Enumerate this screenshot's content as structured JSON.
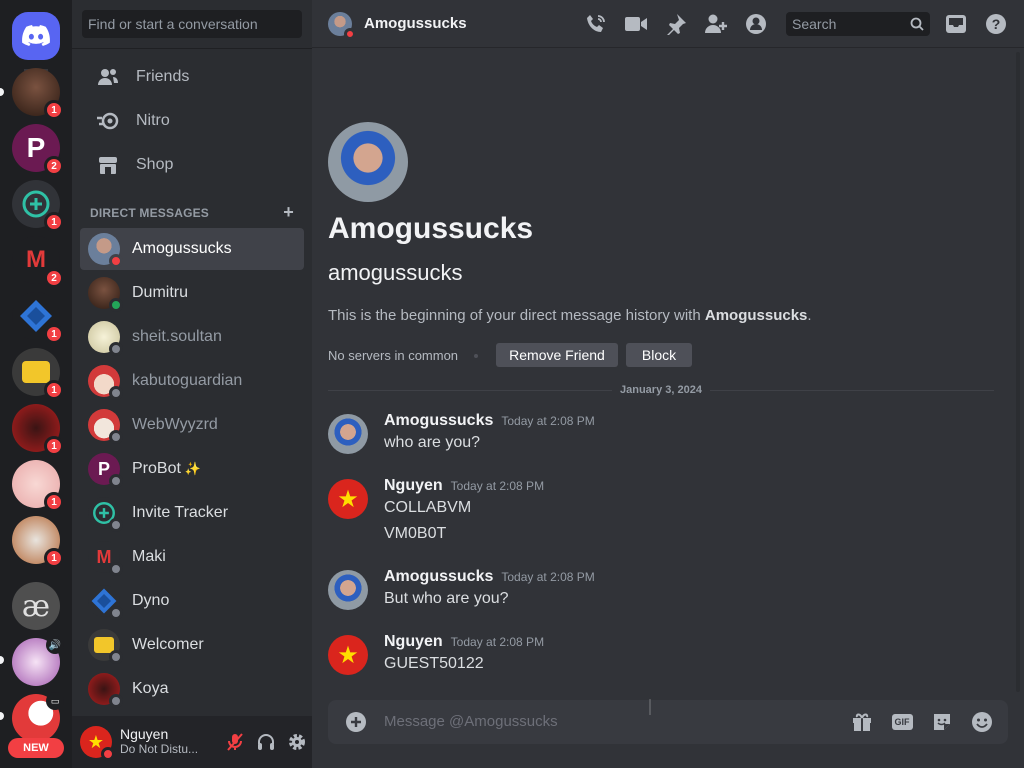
{
  "rail": {
    "servers": [
      {
        "name": "discord-home",
        "badge": ""
      },
      {
        "name": "server-1",
        "badge": "1"
      },
      {
        "name": "server-probot",
        "badge": "2"
      },
      {
        "name": "server-invite-tracker",
        "badge": "1"
      },
      {
        "name": "server-maki",
        "badge": "2"
      },
      {
        "name": "server-dyno",
        "badge": "1"
      },
      {
        "name": "server-welcomer",
        "badge": "1"
      },
      {
        "name": "server-koya",
        "badge": "1"
      },
      {
        "name": "server-anime-girl",
        "badge": "1"
      },
      {
        "name": "server-cyber",
        "badge": "1"
      },
      {
        "name": "server-ae",
        "badge": ""
      },
      {
        "name": "server-voice",
        "badge": ""
      },
      {
        "name": "server-yin",
        "badge": ""
      }
    ],
    "ae_label": "æ",
    "new_label": "NEW"
  },
  "sidebar": {
    "search_placeholder": "Find or start a conversation",
    "nav": [
      {
        "label": "Friends",
        "icon": "friends-icon"
      },
      {
        "label": "Nitro",
        "icon": "nitro-icon"
      },
      {
        "label": "Shop",
        "icon": "shop-icon"
      }
    ],
    "dm_header": "DIRECT MESSAGES",
    "dm_add": "+",
    "dms": [
      {
        "name": "Amogussucks",
        "status": "dnd",
        "active": true
      },
      {
        "name": "Dumitru",
        "status": "on"
      },
      {
        "name": "sheit.soultan",
        "status": "off"
      },
      {
        "name": "kabutoguardian",
        "status": "off"
      },
      {
        "name": "WebWyyzrd",
        "status": "off"
      },
      {
        "name": "ProBot",
        "status": "off",
        "sparkle": "✨"
      },
      {
        "name": "Invite Tracker",
        "status": "off"
      },
      {
        "name": "Maki",
        "status": "off"
      },
      {
        "name": "Dyno",
        "status": "off"
      },
      {
        "name": "Welcomer",
        "status": "off"
      },
      {
        "name": "Koya",
        "status": "off"
      }
    ],
    "user": {
      "name": "Nguyen",
      "status": "Do Not Distu..."
    }
  },
  "topbar": {
    "title": "Amogussucks",
    "search_placeholder": "Search"
  },
  "profile": {
    "display_name": "Amogussucks",
    "username": "amogussucks",
    "intro_prefix": "This is the beginning of your direct message history with ",
    "intro_name": "Amogussucks",
    "intro_suffix": ".",
    "mutual": "No servers in common",
    "remove_friend": "Remove Friend",
    "block": "Block"
  },
  "date_divider": "January 3, 2024",
  "messages": [
    {
      "author": "Amogussucks",
      "time": "Today at 2:08 PM",
      "lines": [
        "who are you?"
      ]
    },
    {
      "author": "Nguyen",
      "time": "Today at 2:08 PM",
      "lines": [
        "COLLABVM",
        "VM0B0T"
      ]
    },
    {
      "author": "Amogussucks",
      "time": "Today at 2:08 PM",
      "lines": [
        "But who are you?"
      ]
    },
    {
      "author": "Nguyen",
      "time": "Today at 2:08 PM",
      "lines": [
        "GUEST50122"
      ]
    }
  ],
  "composer": {
    "placeholder": "Message @Amogussucks",
    "gif_label": "GIF"
  },
  "colors": {
    "accent": "#5865f2",
    "dnd": "#f23f43",
    "online": "#23a559"
  }
}
